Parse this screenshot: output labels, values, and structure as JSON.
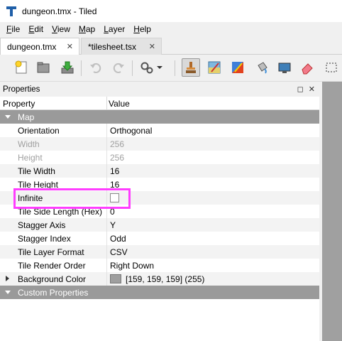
{
  "window": {
    "title": "dungeon.tmx - Tiled"
  },
  "menu": [
    {
      "label": "File",
      "u": "F",
      "rest": "ile"
    },
    {
      "label": "Edit",
      "u": "E",
      "rest": "dit"
    },
    {
      "label": "View",
      "u": "V",
      "rest": "iew"
    },
    {
      "label": "Map",
      "u": "M",
      "rest": "ap"
    },
    {
      "label": "Layer",
      "u": "L",
      "rest": "ayer"
    },
    {
      "label": "Help",
      "u": "H",
      "rest": "elp"
    }
  ],
  "tabs": [
    {
      "label": "dungeon.tmx",
      "close": "✕"
    },
    {
      "label": "*tilesheet.tsx",
      "close": "✕"
    }
  ],
  "panel": {
    "title": "Properties",
    "float_icon": "◻",
    "close_icon": "✕"
  },
  "grid": {
    "col_property": "Property",
    "col_value": "Value",
    "group_map": "Map",
    "group_custom": "Custom Properties",
    "rows": [
      {
        "key": "Orientation",
        "value": "Orthogonal"
      },
      {
        "key": "Width",
        "value": "256"
      },
      {
        "key": "Height",
        "value": "256"
      },
      {
        "key": "Tile Width",
        "value": "16"
      },
      {
        "key": "Tile Height",
        "value": "16"
      },
      {
        "key": "Infinite",
        "value": ""
      },
      {
        "key": "Tile Side Length (Hex)",
        "value": "0"
      },
      {
        "key": "Stagger Axis",
        "value": "Y"
      },
      {
        "key": "Stagger Index",
        "value": "Odd"
      },
      {
        "key": "Tile Layer Format",
        "value": "CSV"
      },
      {
        "key": "Tile Render Order",
        "value": "Right Down"
      },
      {
        "key": "Background Color",
        "value": "[159, 159, 159] (255)"
      }
    ]
  },
  "colors": {
    "group_bg": "#9a9a9a",
    "highlight": "#ff3dff",
    "background_color": "#9f9f9f"
  }
}
